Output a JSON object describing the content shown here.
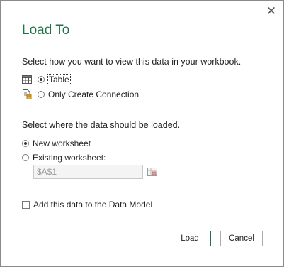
{
  "dialog": {
    "title": "Load To",
    "close_glyph": "✕",
    "view_prompt": "Select how you want to view this data in your workbook.",
    "view_options": [
      {
        "label": "Table",
        "icon": "table-icon",
        "selected": true
      },
      {
        "label": "Only Create Connection",
        "icon": "connection-icon",
        "selected": false
      }
    ],
    "location_prompt": "Select where the data should be loaded.",
    "location_options": [
      {
        "label": "New worksheet",
        "selected": true
      },
      {
        "label": "Existing worksheet:",
        "selected": false
      }
    ],
    "existing_worksheet_value": "$A$1",
    "data_model_label": "Add this data to the Data Model",
    "data_model_checked": false,
    "load_label": "Load",
    "cancel_label": "Cancel",
    "accent_color": "#217346"
  }
}
